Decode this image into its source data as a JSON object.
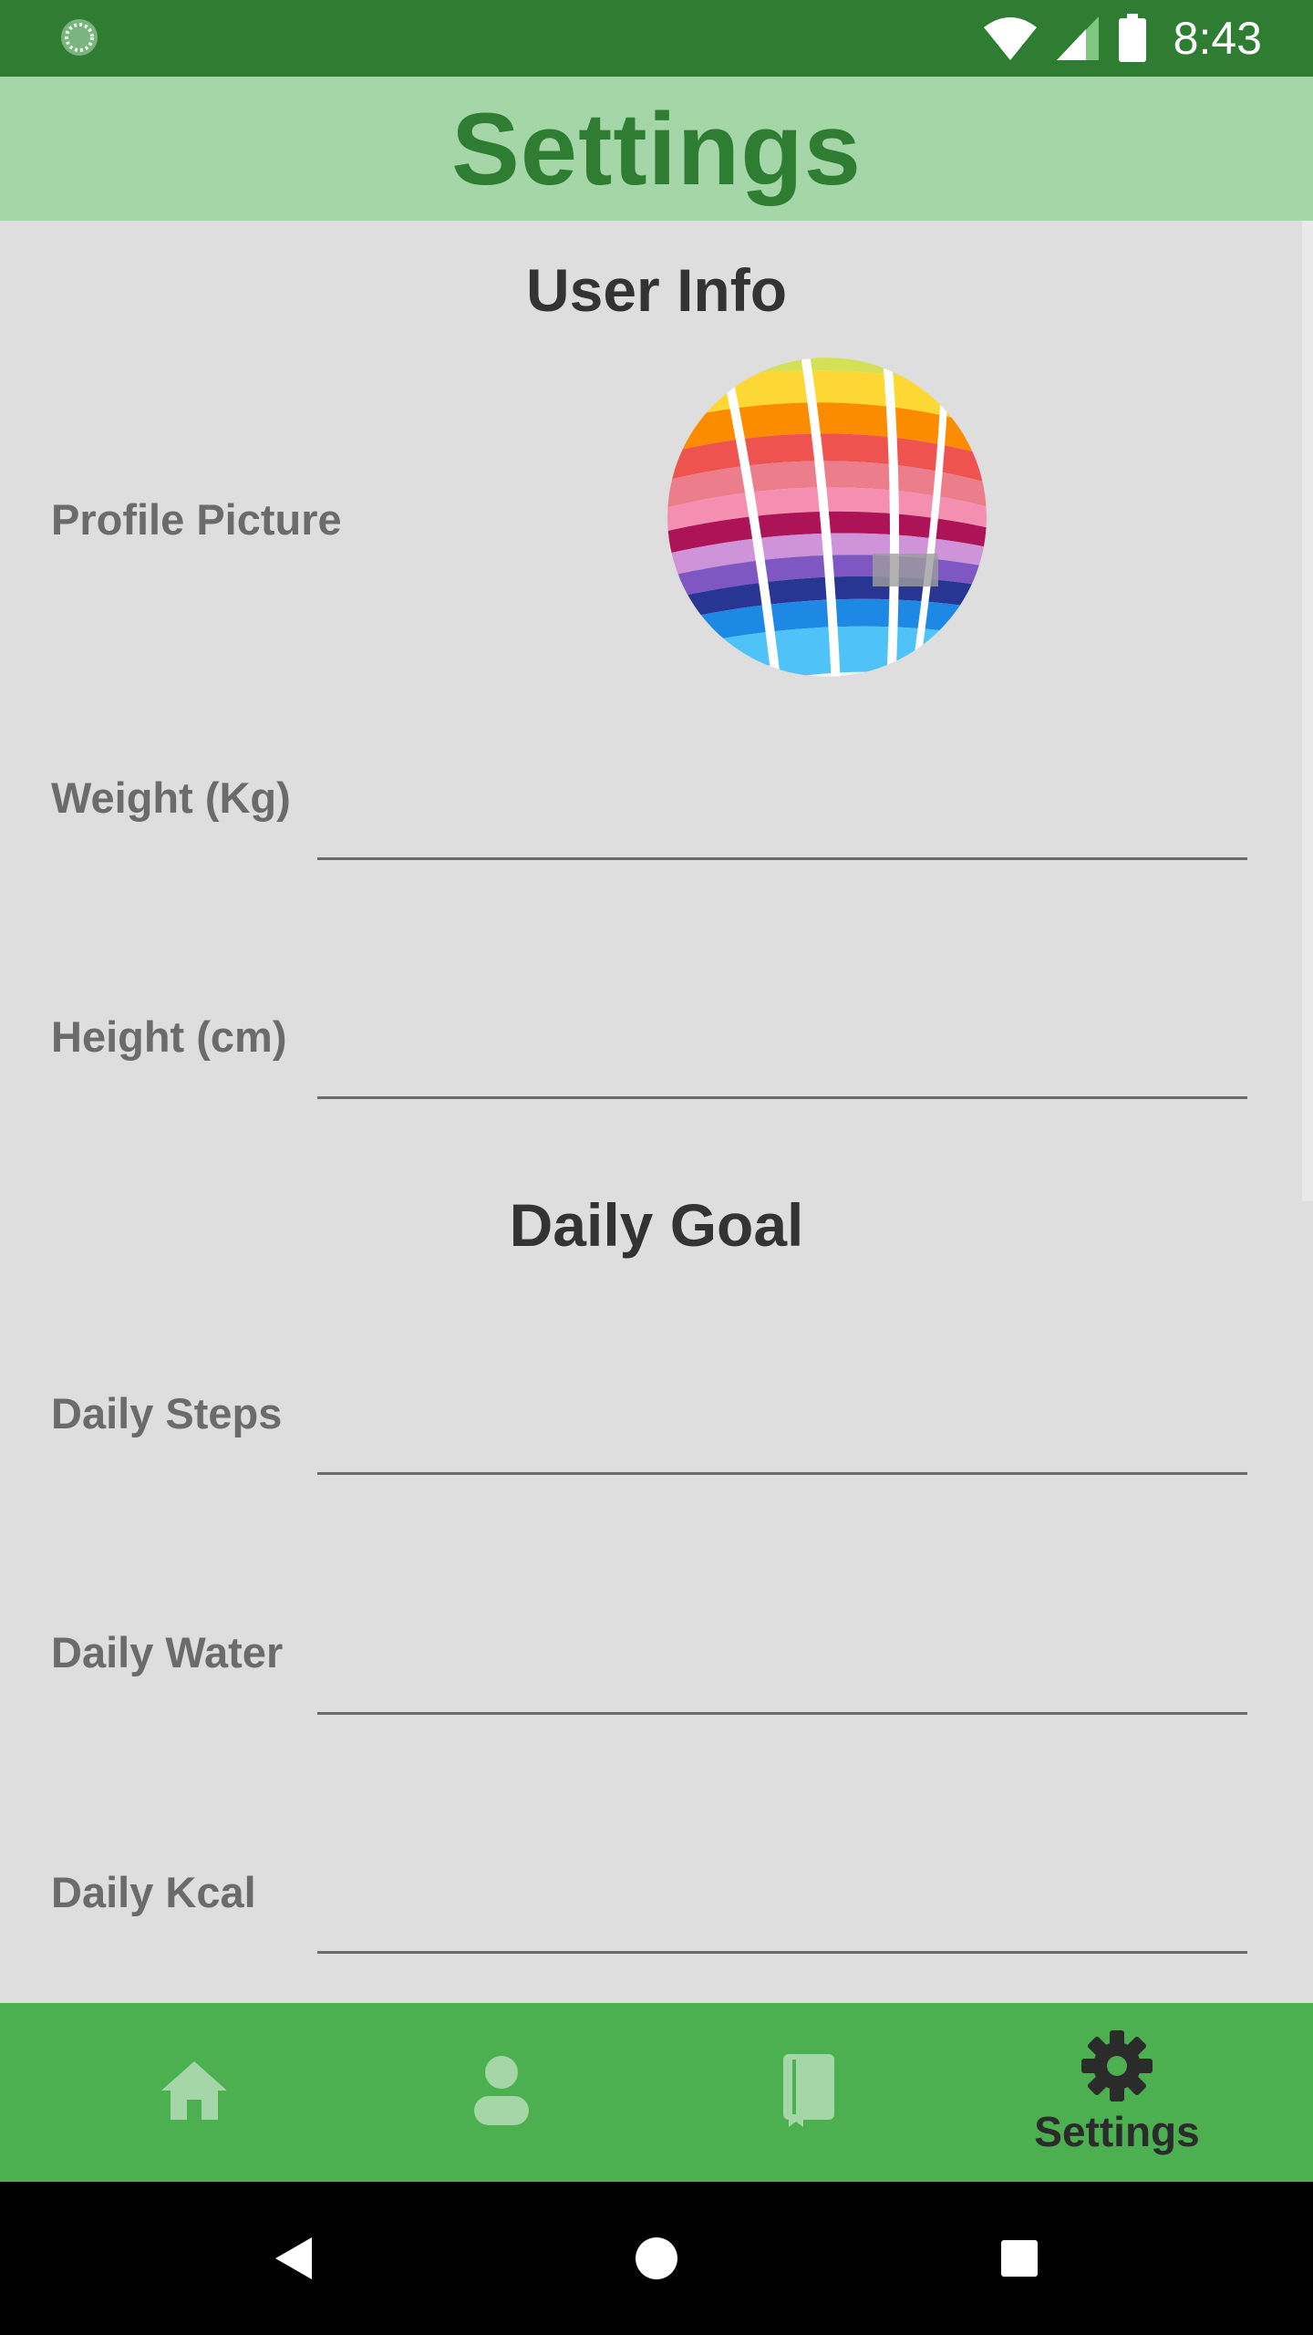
{
  "status_bar": {
    "time": "8:43"
  },
  "header": {
    "title": "Settings"
  },
  "user_info": {
    "section_title": "User Info",
    "profile_picture_label": "Profile Picture",
    "weight_label": "Weight (Kg)",
    "weight_value": "",
    "height_label": "Height (cm)",
    "height_value": ""
  },
  "daily_goal": {
    "section_title": "Daily Goal",
    "steps_label": "Daily Steps",
    "steps_value": "",
    "water_label": "Daily Water",
    "water_value": "",
    "kcal_label": "Daily Kcal",
    "kcal_value": ""
  },
  "bottom_nav": {
    "items": [
      {
        "icon": "home-icon",
        "label": ""
      },
      {
        "icon": "person-icon",
        "label": ""
      },
      {
        "icon": "book-icon",
        "label": ""
      },
      {
        "icon": "gear-icon",
        "label": "Settings"
      }
    ],
    "active_index": 3
  },
  "colors": {
    "status_bar": "#2e7d32",
    "title_bar": "#a5d6a7",
    "title_text": "#2e7d32",
    "bottom_nav": "#4caf50",
    "inactive_icon": "#a5d6a7",
    "active_icon": "#2b2b2b",
    "background": "#dedede"
  }
}
